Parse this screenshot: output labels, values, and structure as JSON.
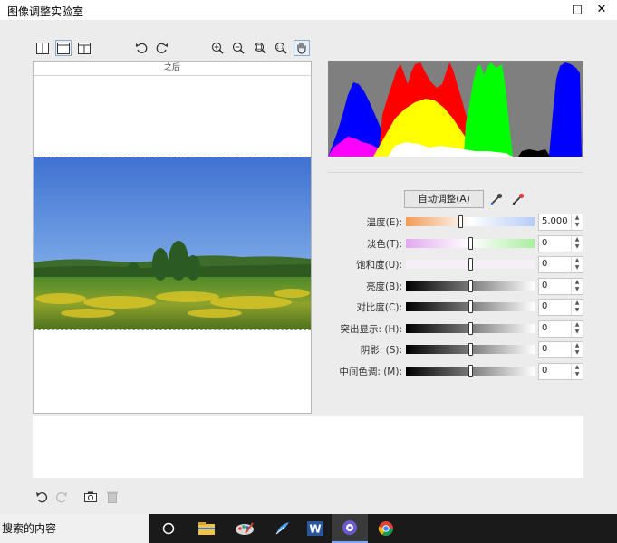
{
  "window": {
    "title": "图像调整实验室",
    "maximize_glyph": "□",
    "close_glyph": "✕"
  },
  "toolbar": {
    "icons": [
      "original-view-icon",
      "after-view-icon",
      "split-view-icon",
      "rotate-left-icon",
      "rotate-right-icon",
      "zoom-in-icon",
      "zoom-out-icon",
      "zoom-fit-icon",
      "zoom-actual-icon",
      "pan-hand-icon"
    ],
    "zoom_actual_text": "1:1"
  },
  "preview": {
    "header_label": "之后"
  },
  "histogram": {
    "background": "#7f7f7f",
    "channels": [
      "blue",
      "magenta",
      "red",
      "yellow",
      "green",
      "white"
    ]
  },
  "adjust": {
    "auto_button_label": "自动调整(A)",
    "sliders": [
      {
        "label": "温度(E):",
        "value": "5,000",
        "level": 0.42,
        "track_gradient": [
          "#f29b55",
          "#ffffff",
          "#b6ccf6"
        ]
      },
      {
        "label": "淡色(T):",
        "value": "0",
        "level": 0.5,
        "track_gradient": [
          "#e3a8ee",
          "#ffffff",
          "#a9ee9e"
        ]
      },
      {
        "label": "饱和度(U):",
        "value": "0",
        "level": 0.5,
        "track_gradient": [
          "#f6eff7",
          "#f6eff7",
          "#f6eff7"
        ]
      },
      {
        "label": "亮度(B):",
        "value": "0",
        "level": 0.5,
        "track_gradient": [
          "#000000",
          "#7a7a7a",
          "#ffffff"
        ]
      },
      {
        "label": "对比度(C):",
        "value": "0",
        "level": 0.5,
        "track_gradient": [
          "#000000",
          "#7a7a7a",
          "#ffffff"
        ]
      },
      {
        "label": "突出显示: (H):",
        "value": "0",
        "level": 0.5,
        "track_gradient": [
          "#000000",
          "#7a7a7a",
          "#ffffff"
        ]
      },
      {
        "label": "阴影: (S):",
        "value": "0",
        "level": 0.5,
        "track_gradient": [
          "#000000",
          "#7a7a7a",
          "#ffffff"
        ]
      },
      {
        "label": "中间色调: (M):",
        "value": "0",
        "level": 0.5,
        "track_gradient": [
          "#000000",
          "#7a7a7a",
          "#ffffff"
        ]
      }
    ]
  },
  "bottom_toolbar": {
    "icons": [
      "undo-icon",
      "redo-icon",
      "snapshot-icon",
      "delete-icon"
    ]
  },
  "taskbar": {
    "search_text": "搜索的内容",
    "word_letter": "W",
    "apps": [
      "task-view-icon",
      "file-explorer-icon",
      "paint-icon",
      "feather-app-icon",
      "word-icon",
      "media-player-icon",
      "chrome-icon"
    ]
  }
}
